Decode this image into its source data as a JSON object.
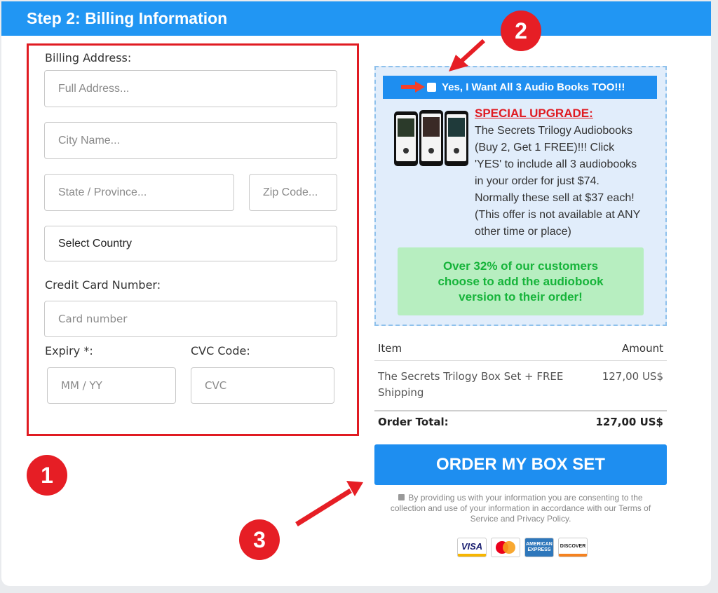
{
  "header": {
    "title": "Step 2: Billing Information"
  },
  "billing": {
    "address_label": "Billing Address:",
    "full_address_placeholder": "Full Address...",
    "city_placeholder": "City Name...",
    "state_placeholder": "State / Province...",
    "zip_placeholder": "Zip Code...",
    "country_value": "Select Country",
    "card_label": "Credit Card Number:",
    "card_placeholder": "Card number",
    "expiry_label": "Expiry *:",
    "expiry_placeholder": "MM / YY",
    "cvc_label": "CVC Code:",
    "cvc_placeholder": "CVC"
  },
  "upsell": {
    "checkbox_label": "Yes, I Want All 3 Audio Books TOO!!!",
    "heading": "SPECIAL UPGRADE:",
    "lines": [
      "The Secrets Trilogy Audiobooks",
      "(Buy 2, Get 1 FREE)!!! Click",
      "'YES' to include all 3 audiobooks",
      "in your order for just $74.",
      "Normally these sell at $37 each!",
      "(This offer is not available at ANY",
      "other time or place)"
    ],
    "social_proof": [
      "Over 32% of our customers",
      "choose to add the audiobook",
      "version to their order!"
    ]
  },
  "order": {
    "col_item": "Item",
    "col_amount": "Amount",
    "item_line1": "The Secrets Trilogy Box Set + FREE",
    "item_line2": "Shipping",
    "item_amount": "127,00 US$",
    "total_label": "Order Total:",
    "total_amount": "127,00 US$",
    "button_label": "ORDER MY BOX SET",
    "consent_lines": [
      "By providing us with your information you are consenting to the",
      "collection and use of your information in accordance with our Terms of",
      "Service and Privacy Policy."
    ]
  },
  "payment_cards": [
    "VISA",
    "MasterCard",
    "AMERICAN EXPRESS",
    "DISCOVER"
  ],
  "annotations": {
    "badge1": "1",
    "badge2": "2",
    "badge3": "3"
  },
  "colors": {
    "brand_blue": "#2196f3",
    "button_blue": "#1e8ef0",
    "annotation_red": "#e61e25",
    "upsell_bg": "#e1edfb",
    "proof_green": "#16b43a"
  },
  "icons": [
    "lock-icon",
    "red-arrow-icon",
    "audiobook-phones-image",
    "visa-icon",
    "mastercard-icon",
    "amex-icon",
    "discover-icon"
  ]
}
